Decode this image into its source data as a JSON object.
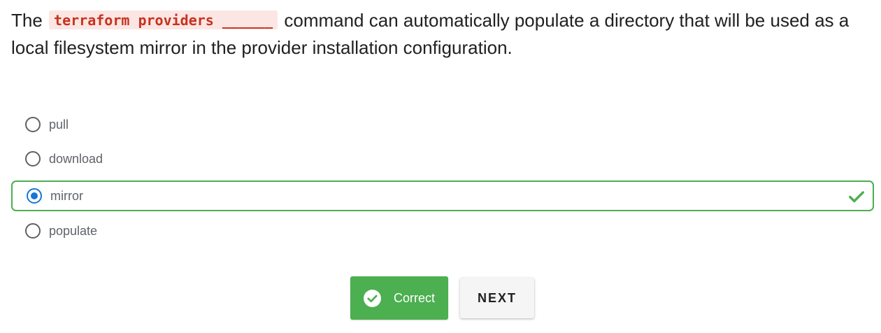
{
  "question": {
    "prefix": "The",
    "code": "terraform providers ______",
    "suffix": "command can automatically populate a directory that will be used as a local filesystem mirror in the provider installation configuration."
  },
  "options": [
    {
      "label": "pull",
      "selected": false,
      "correct": false
    },
    {
      "label": "download",
      "selected": false,
      "correct": false
    },
    {
      "label": "mirror",
      "selected": true,
      "correct": true
    },
    {
      "label": "populate",
      "selected": false,
      "correct": false
    }
  ],
  "result_button": {
    "label": "Correct",
    "icon": "check-circle-icon"
  },
  "next_button": {
    "label": "NEXT"
  },
  "colors": {
    "correct_green": "#4caf50",
    "radio_selected": "#1976d2",
    "code_text": "#c7321f",
    "code_bg": "#fbe6e3"
  }
}
